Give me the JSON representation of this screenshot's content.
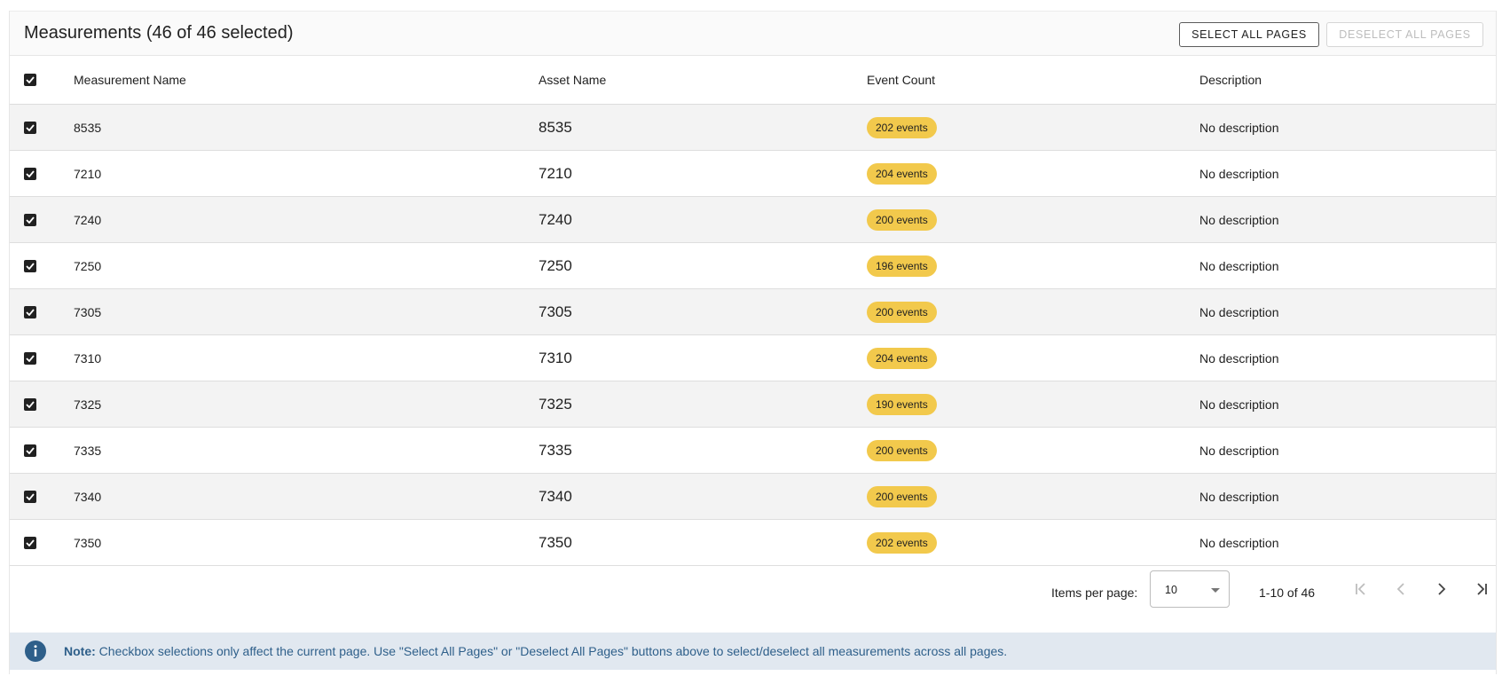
{
  "header": {
    "title": "Measurements (46 of 46 selected)",
    "select_all_label": "SELECT ALL PAGES",
    "deselect_all_label": "DESELECT ALL PAGES"
  },
  "table": {
    "columns": [
      "Measurement Name",
      "Asset Name",
      "Event Count",
      "Description"
    ],
    "header_checked": true,
    "rows": [
      {
        "checked": true,
        "name": "8535",
        "asset": "8535",
        "events": "202 events",
        "description": "No description"
      },
      {
        "checked": true,
        "name": "7210",
        "asset": "7210",
        "events": "204 events",
        "description": "No description"
      },
      {
        "checked": true,
        "name": "7240",
        "asset": "7240",
        "events": "200 events",
        "description": "No description"
      },
      {
        "checked": true,
        "name": "7250",
        "asset": "7250",
        "events": "196 events",
        "description": "No description"
      },
      {
        "checked": true,
        "name": "7305",
        "asset": "7305",
        "events": "200 events",
        "description": "No description"
      },
      {
        "checked": true,
        "name": "7310",
        "asset": "7310",
        "events": "204 events",
        "description": "No description"
      },
      {
        "checked": true,
        "name": "7325",
        "asset": "7325",
        "events": "190 events",
        "description": "No description"
      },
      {
        "checked": true,
        "name": "7335",
        "asset": "7335",
        "events": "200 events",
        "description": "No description"
      },
      {
        "checked": true,
        "name": "7340",
        "asset": "7340",
        "events": "200 events",
        "description": "No description"
      },
      {
        "checked": true,
        "name": "7350",
        "asset": "7350",
        "events": "202 events",
        "description": "No description"
      }
    ]
  },
  "paginator": {
    "items_per_page_label": "Items per page:",
    "items_per_page_value": "10",
    "range_label": "1-10 of 46"
  },
  "note": {
    "label": "Note:",
    "text": " Checkbox selections only affect the current page. Use \"Select All Pages\" or \"Deselect All Pages\" buttons above to select/deselect all measurements across all pages."
  },
  "colors": {
    "badge": "#f2c94c",
    "note_background": "#e1e8f0",
    "note_text": "#2e5f8a",
    "checkbox": "#212121"
  },
  "icons": {
    "checkbox": "check-icon",
    "select_caret": "caret-down-icon",
    "first_page": "first-page-icon",
    "prev_page": "chevron-left-icon",
    "next_page": "chevron-right-icon",
    "last_page": "last-page-icon",
    "note": "info-icon"
  }
}
